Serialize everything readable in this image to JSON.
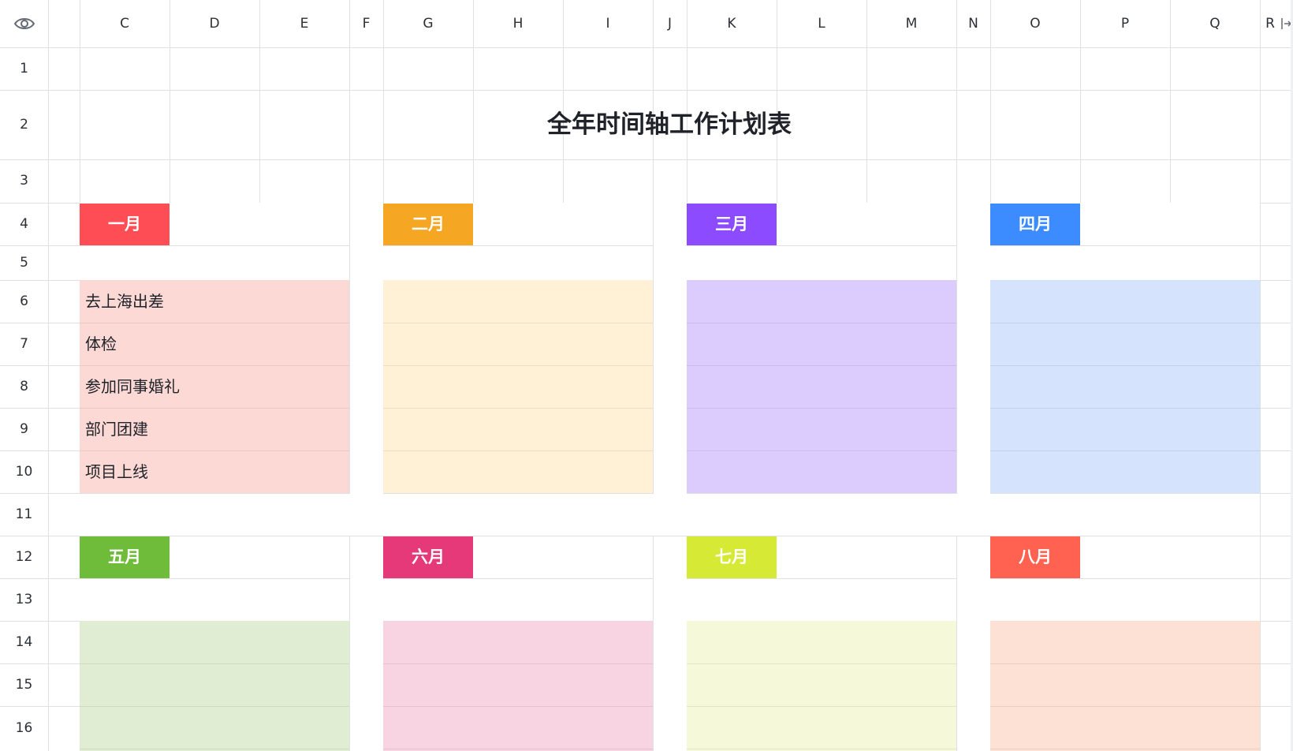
{
  "sheet": {
    "title": "全年时间轴工作计划表",
    "columns": [
      "C",
      "D",
      "E",
      "F",
      "G",
      "H",
      "I",
      "J",
      "K",
      "L",
      "M",
      "N",
      "O",
      "P",
      "Q",
      "R"
    ],
    "rows": [
      "1",
      "2",
      "3",
      "4",
      "5",
      "6",
      "7",
      "8",
      "9",
      "10",
      "11",
      "12",
      "13",
      "14",
      "15",
      "16"
    ],
    "months_row1": [
      {
        "label": "一月",
        "color": "#ff4d55",
        "block": "#fdd9d6"
      },
      {
        "label": "二月",
        "color": "#f5a623",
        "block": "#fff1d6"
      },
      {
        "label": "三月",
        "color": "#8c4bff",
        "block": "#dccbfd"
      },
      {
        "label": "四月",
        "color": "#3c8cff",
        "block": "#d5e3fd"
      }
    ],
    "months_row2": [
      {
        "label": "五月",
        "color": "#6fbc3a",
        "block": "#e0edd2"
      },
      {
        "label": "六月",
        "color": "#e6397a",
        "block": "#f8d4e2"
      },
      {
        "label": "七月",
        "color": "#d6ea35",
        "block": "#f6f9d9"
      },
      {
        "label": "八月",
        "color": "#ff6250",
        "block": "#fde1d4"
      }
    ],
    "tasks_january": [
      "去上海出差",
      "体检",
      "参加同事婚礼",
      "部门团建",
      "项目上线"
    ]
  }
}
